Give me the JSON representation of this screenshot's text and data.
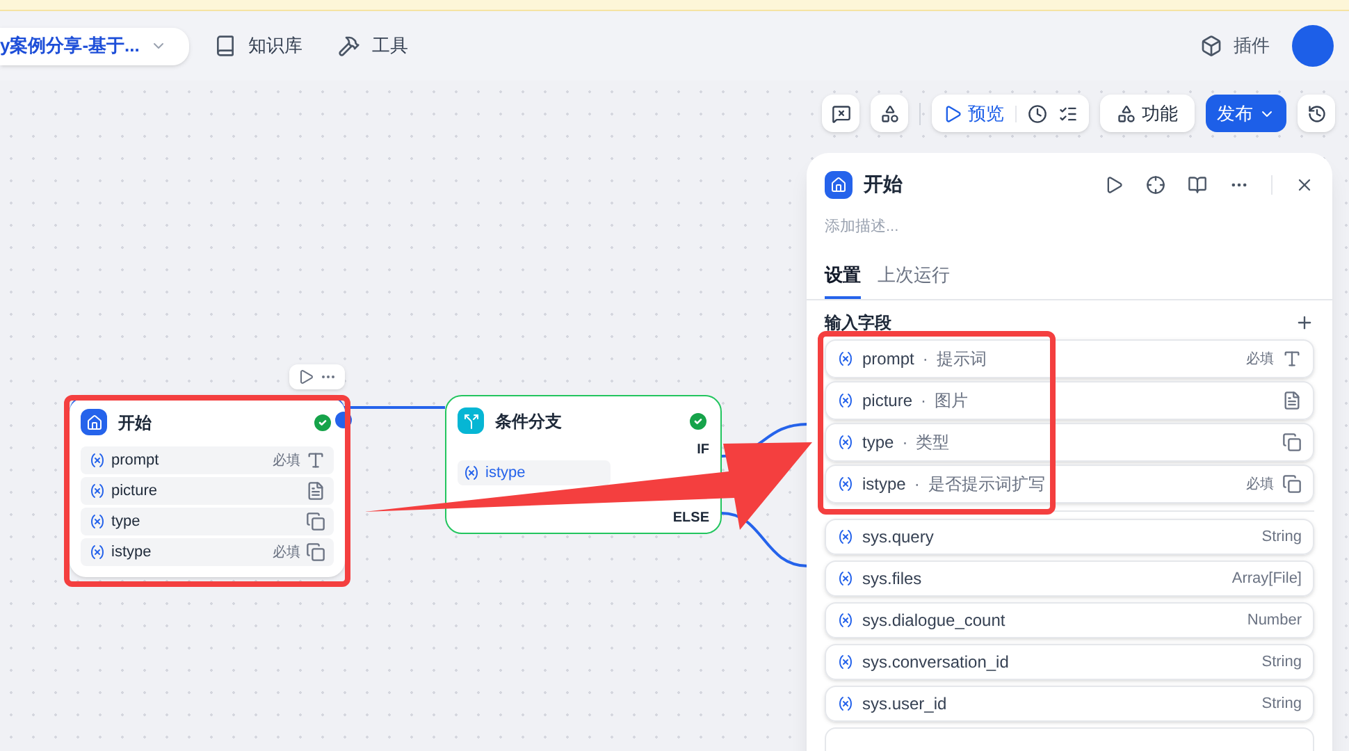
{
  "header": {
    "app_title": "y案例分享-基于...",
    "nav": [
      {
        "label": "知识库",
        "kind": "book"
      },
      {
        "label": "工具",
        "kind": "tool"
      }
    ],
    "plugin": "插件"
  },
  "toolbar": {
    "preview": "预览",
    "features": "功能",
    "publish": "发布"
  },
  "start_node": {
    "title": "开始",
    "completed": true,
    "variables": [
      {
        "name": "prompt",
        "required": "必填",
        "kind": "text"
      },
      {
        "name": "picture",
        "kind": "file"
      },
      {
        "name": "type",
        "kind": "select"
      },
      {
        "name": "istype",
        "required": "必填",
        "kind": "select"
      }
    ]
  },
  "condition_node": {
    "title": "条件分支",
    "completed": true,
    "condition_variable": "istype",
    "branches": [
      "IF",
      "ELSE"
    ]
  },
  "panel": {
    "title": "开始",
    "description_placeholder": "添加描述...",
    "tabs": [
      {
        "label": "设置",
        "selected": true
      },
      {
        "label": "上次运行",
        "selected": false
      }
    ],
    "section": "输入字段",
    "inputs": [
      {
        "name": "prompt",
        "separator": "·",
        "label": "提示词",
        "required": "必填",
        "kind": "text"
      },
      {
        "name": "picture",
        "separator": "·",
        "label": "图片",
        "kind": "file"
      },
      {
        "name": "type",
        "separator": "·",
        "label": "类型",
        "kind": "select"
      },
      {
        "name": "istype",
        "separator": "·",
        "label": "是否提示词扩写",
        "required": "必填",
        "kind": "select"
      }
    ],
    "system_variables": [
      {
        "name": "sys.query",
        "type": "String"
      },
      {
        "name": "sys.files",
        "type": "Array[File]"
      },
      {
        "name": "sys.dialogue_count",
        "type": "Number"
      },
      {
        "name": "sys.conversation_id",
        "type": "String"
      },
      {
        "name": "sys.user_id",
        "type": "String"
      }
    ]
  }
}
